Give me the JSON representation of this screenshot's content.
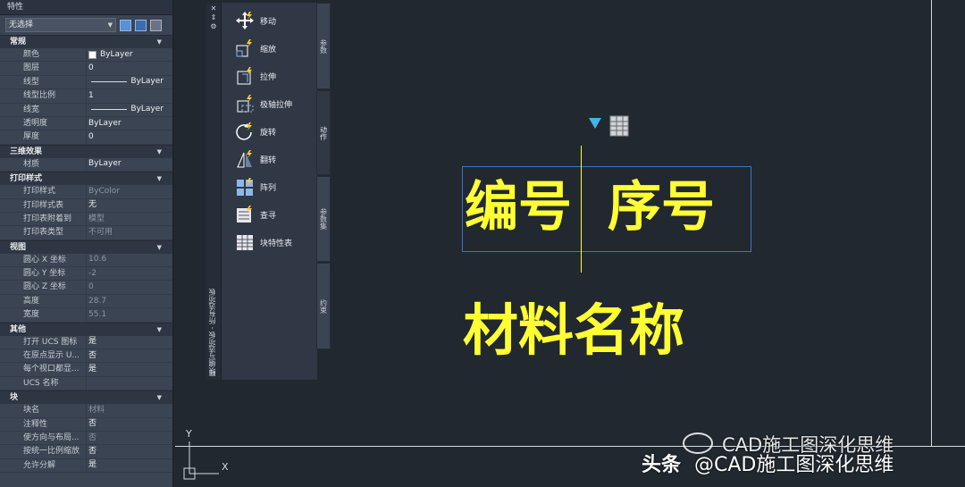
{
  "properties": {
    "title": "特性",
    "selection": "无选择",
    "sections": [
      {
        "name": "常规",
        "rows": [
          {
            "k": "颜色",
            "v": "ByLayer",
            "type": "color"
          },
          {
            "k": "图层",
            "v": "0"
          },
          {
            "k": "线型",
            "v": "ByLayer",
            "type": "line"
          },
          {
            "k": "线型比例",
            "v": "1"
          },
          {
            "k": "线宽",
            "v": "ByLayer",
            "type": "line"
          },
          {
            "k": "透明度",
            "v": "ByLayer"
          },
          {
            "k": "厚度",
            "v": "0"
          }
        ]
      },
      {
        "name": "三维效果",
        "rows": [
          {
            "k": "材质",
            "v": "ByLayer"
          }
        ]
      },
      {
        "name": "打印样式",
        "rows": [
          {
            "k": "打印样式",
            "v": "ByColor",
            "dim": true
          },
          {
            "k": "打印样式表",
            "v": "无"
          },
          {
            "k": "打印表附着到",
            "v": "模型",
            "dim": true
          },
          {
            "k": "打印表类型",
            "v": "不可用",
            "dim": true
          }
        ]
      },
      {
        "name": "视图",
        "rows": [
          {
            "k": "圆心 X 坐标",
            "v": "10.6",
            "dim": true
          },
          {
            "k": "圆心 Y 坐标",
            "v": "-2",
            "dim": true
          },
          {
            "k": "圆心 Z 坐标",
            "v": "0",
            "dim": true
          },
          {
            "k": "高度",
            "v": "28.7",
            "dim": true
          },
          {
            "k": "宽度",
            "v": "55.1",
            "dim": true
          }
        ]
      },
      {
        "name": "其他",
        "rows": [
          {
            "k": "打开 UCS 图标",
            "v": "是"
          },
          {
            "k": "在原点显示 U...",
            "v": "否"
          },
          {
            "k": "每个视口都显...",
            "v": "是"
          },
          {
            "k": "UCS 名称",
            "v": ""
          }
        ]
      },
      {
        "name": "块",
        "rows": [
          {
            "k": "块名",
            "v": "材料",
            "dim": true
          },
          {
            "k": "注释性",
            "v": "否"
          },
          {
            "k": "使方向与布局...",
            "v": "否",
            "dim": true
          },
          {
            "k": "按统一比例缩放",
            "v": "否"
          },
          {
            "k": "允许分解",
            "v": "是"
          }
        ]
      }
    ]
  },
  "palette": {
    "title": "块编写选项板 - 所有选项板",
    "tools": [
      {
        "label": "移动",
        "icon": "move-icon"
      },
      {
        "label": "缩放",
        "icon": "scale-icon"
      },
      {
        "label": "拉伸",
        "icon": "stretch-icon"
      },
      {
        "label": "极轴拉伸",
        "icon": "polar-stretch-icon"
      },
      {
        "label": "旋转",
        "icon": "rotate-icon"
      },
      {
        "label": "翻转",
        "icon": "flip-icon"
      },
      {
        "label": "阵列",
        "icon": "array-icon"
      },
      {
        "label": "查寻",
        "icon": "lookup-icon"
      },
      {
        "label": "块特性表",
        "icon": "block-table-icon"
      }
    ],
    "tabs": [
      "参数",
      "动作",
      "参数集",
      "约束"
    ],
    "active_tab": "动作"
  },
  "drawing": {
    "text1": "编号",
    "text2": "序号",
    "text3": "材料名称",
    "ucs_y": "Y",
    "ucs_x": "X"
  },
  "watermark": {
    "wechat": "CAD施工图深化思维",
    "toutiao_prefix": "头条",
    "toutiao": "@CAD施工图深化思维"
  },
  "colors": {
    "text": "#ffff33",
    "grip": "#3fb7e8",
    "selection": "#3b78c4",
    "canvas": "#212830"
  }
}
